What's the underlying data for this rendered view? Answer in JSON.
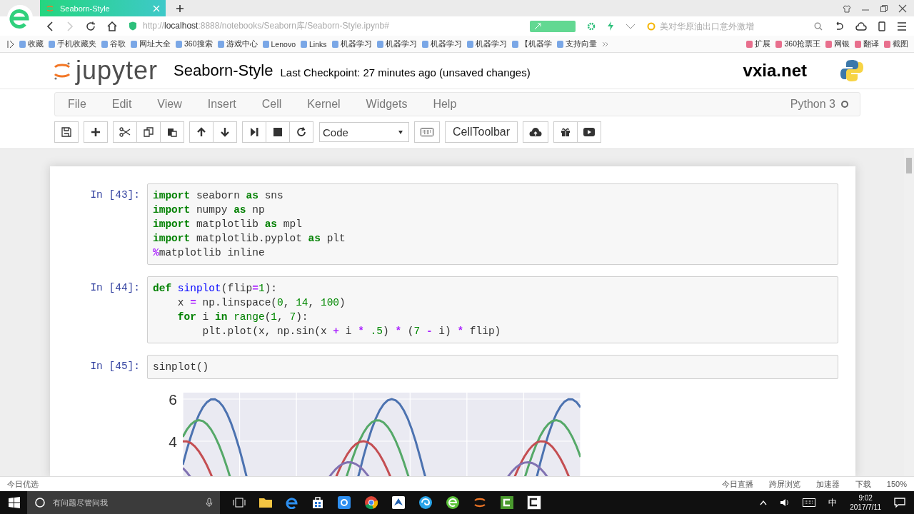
{
  "browser": {
    "tab": {
      "title": "Seaborn-Style",
      "selected": true
    },
    "url": {
      "scheme": "http://",
      "host": "localhost",
      "rest": ":8888/notebooks/Seaborn库/Seaborn-Style.ipynb#"
    },
    "search": {
      "placeholder": "美对华原油出口意外激增"
    },
    "bookmarks": [
      "收藏",
      "手机收藏夹",
      "谷歌",
      "网址大全",
      "360搜索",
      "游戏中心",
      "Lenovo",
      "Links",
      "机器学习",
      "机器学习",
      "机器学习",
      "机器学习",
      "【机器学",
      "支持向量"
    ],
    "extensions": [
      "扩展",
      "360抢票王",
      "网银",
      "翻译",
      "截图"
    ]
  },
  "jupyter": {
    "logo_text": "jupyter",
    "notebook_name": "Seaborn-Style",
    "checkpoint": "Last Checkpoint: 27 minutes ago (unsaved changes)",
    "site": "vxia.net",
    "menu": [
      "File",
      "Edit",
      "View",
      "Insert",
      "Cell",
      "Kernel",
      "Widgets",
      "Help"
    ],
    "kernel": {
      "name": "Python 3",
      "busy": false
    },
    "cell_type": "Code",
    "celltoolbar": "CellToolbar"
  },
  "cells": [
    {
      "prompt": "In [43]:",
      "lines": [
        [
          {
            "t": "import",
            "kind": "kw"
          },
          {
            "t": " seaborn ",
            "kind": "p"
          },
          {
            "t": "as",
            "kind": "kw"
          },
          {
            "t": " sns",
            "kind": "p"
          }
        ],
        [
          {
            "t": "import",
            "kind": "kw"
          },
          {
            "t": " numpy ",
            "kind": "p"
          },
          {
            "t": "as",
            "kind": "kw"
          },
          {
            "t": " np",
            "kind": "p"
          }
        ],
        [
          {
            "t": "import",
            "kind": "kw"
          },
          {
            "t": " matplotlib ",
            "kind": "p"
          },
          {
            "t": "as",
            "kind": "kw"
          },
          {
            "t": " mpl",
            "kind": "p"
          }
        ],
        [
          {
            "t": "import",
            "kind": "kw"
          },
          {
            "t": " matplotlib.pyplot ",
            "kind": "p"
          },
          {
            "t": "as",
            "kind": "kw"
          },
          {
            "t": " plt",
            "kind": "p"
          }
        ],
        [
          {
            "t": "%",
            "kind": "op"
          },
          {
            "t": "matplotlib inline",
            "kind": "p"
          }
        ]
      ]
    },
    {
      "prompt": "In [44]:",
      "lines": [
        [
          {
            "t": "def",
            "kind": "kw"
          },
          {
            "t": " sinplot",
            "kind": "fn"
          },
          {
            "t": "(flip",
            "kind": "p"
          },
          {
            "t": "=",
            "kind": "op"
          },
          {
            "t": "1",
            "kind": "num"
          },
          {
            "t": "):",
            "kind": "p"
          }
        ],
        [
          {
            "t": "    x ",
            "kind": "p"
          },
          {
            "t": "=",
            "kind": "op"
          },
          {
            "t": " np.linspace(",
            "kind": "p"
          },
          {
            "t": "0",
            "kind": "num"
          },
          {
            "t": ", ",
            "kind": "p"
          },
          {
            "t": "14",
            "kind": "num"
          },
          {
            "t": ", ",
            "kind": "p"
          },
          {
            "t": "100",
            "kind": "num"
          },
          {
            "t": ")",
            "kind": "p"
          }
        ],
        [
          {
            "t": "    for",
            "kind": "kw"
          },
          {
            "t": " i ",
            "kind": "p"
          },
          {
            "t": "in",
            "kind": "kw"
          },
          {
            "t": " range",
            "kind": "bi"
          },
          {
            "t": "(",
            "kind": "p"
          },
          {
            "t": "1",
            "kind": "num"
          },
          {
            "t": ", ",
            "kind": "p"
          },
          {
            "t": "7",
            "kind": "num"
          },
          {
            "t": "):",
            "kind": "p"
          }
        ],
        [
          {
            "t": "        plt.plot(x, np.sin(x ",
            "kind": "p"
          },
          {
            "t": "+",
            "kind": "op"
          },
          {
            "t": " i ",
            "kind": "p"
          },
          {
            "t": "*",
            "kind": "op"
          },
          {
            "t": " .5",
            "kind": "num"
          },
          {
            "t": ") ",
            "kind": "p"
          },
          {
            "t": "*",
            "kind": "op"
          },
          {
            "t": " (",
            "kind": "p"
          },
          {
            "t": "7",
            "kind": "num"
          },
          {
            "t": " -",
            "kind": "op"
          },
          {
            "t": " i) ",
            "kind": "p"
          },
          {
            "t": "*",
            "kind": "op"
          },
          {
            "t": " flip)",
            "kind": "p"
          }
        ]
      ]
    },
    {
      "prompt": "In [45]:",
      "lines": [
        [
          {
            "t": "sinplot()",
            "kind": "p"
          }
        ]
      ],
      "output": {
        "kind": "plot",
        "y_tick_labels": [
          "6",
          "4"
        ]
      }
    }
  ],
  "status_bar": {
    "left": "今日优选",
    "items": [
      "今日直播",
      "跨屏浏览",
      "加速器",
      "下载"
    ],
    "zoom": "150%"
  },
  "taskbar": {
    "search": {
      "placeholder": "有问题尽管问我"
    },
    "ime": "中",
    "time": "9:02",
    "date": "2017/7/11"
  }
}
